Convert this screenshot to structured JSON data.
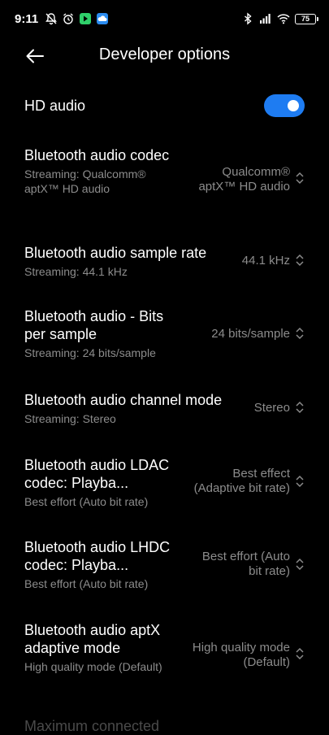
{
  "status_bar": {
    "time": "9:11",
    "battery": "75"
  },
  "header": {
    "title": "Developer options"
  },
  "hd_audio": {
    "label": "HD audio",
    "enabled": true
  },
  "settings": [
    {
      "title": "Bluetooth audio codec",
      "subtitle": "Streaming: Qualcomm® aptX™ HD audio",
      "value": "Qualcomm® aptX™ HD audio"
    },
    {
      "title": "Bluetooth audio sample rate",
      "subtitle": "Streaming: 44.1 kHz",
      "value": "44.1 kHz"
    },
    {
      "title": "Bluetooth audio - Bits per sample",
      "subtitle": "Streaming: 24 bits/sample",
      "value": "24 bits/sample"
    },
    {
      "title": "Bluetooth audio channel mode",
      "subtitle": "Streaming: Stereo",
      "value": "Stereo"
    },
    {
      "title": "Bluetooth audio LDAC codec: Playba...",
      "subtitle": "Best effort (Auto bit rate)",
      "value": "Best effect (Adaptive bit rate)"
    },
    {
      "title": "Bluetooth audio LHDC codec: Playba...",
      "subtitle": "Best effort (Auto bit rate)",
      "value": "Best effort (Auto bit rate)"
    },
    {
      "title": "Bluetooth audio aptX adaptive mode",
      "subtitle": "High quality mode (Default)",
      "value": "High quality mode (Default)"
    }
  ],
  "partial_item": {
    "title": "Maximum connected"
  },
  "colors": {
    "background": "#000000",
    "accent": "#1e7cf2",
    "secondary_text": "#8c8c8c"
  }
}
